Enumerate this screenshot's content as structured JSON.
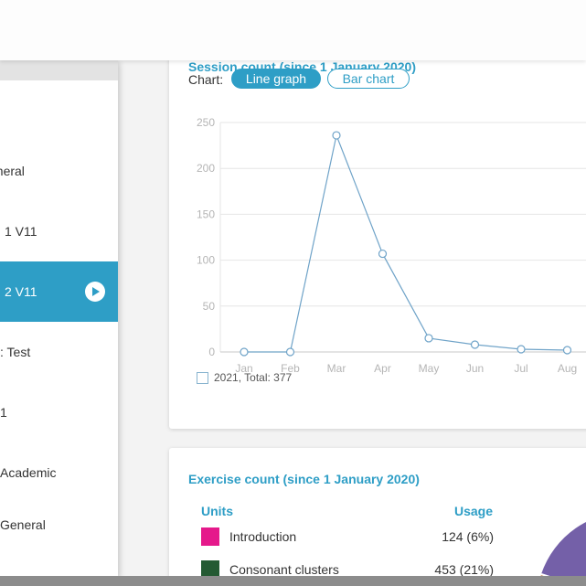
{
  "sidebar": {
    "items": [
      {
        "label": "eneral",
        "active": false
      },
      {
        "label": "1 V11",
        "active": false
      },
      {
        "label": "2 V11",
        "active": true
      },
      {
        "label": ": Test",
        "active": false
      },
      {
        "label": "1",
        "active": false
      },
      {
        "label": "Academic",
        "active": false
      },
      {
        "label": "General",
        "active": false
      }
    ]
  },
  "session_card": {
    "title": "Session count (since 1 January 2020)",
    "chart_label": "Chart:",
    "buttons": {
      "line": "Line graph",
      "bar": "Bar chart"
    },
    "legend": "2021, Total: 377"
  },
  "exercise_card": {
    "title": "Exercise count (since 1 January 2020)",
    "headers": {
      "units": "Units",
      "usage": "Usage"
    },
    "rows": [
      {
        "name": "Introduction",
        "usage": "124 (6%)",
        "color": "#e5198b"
      },
      {
        "name": "Consonant clusters",
        "usage": "453 (21%)",
        "color": "#245a33"
      }
    ],
    "pie_colors": [
      "#7460a8",
      "#c4865a"
    ]
  },
  "chart_data": {
    "type": "line",
    "categories": [
      "Jan",
      "Feb",
      "Mar",
      "Apr",
      "May",
      "Jun",
      "Jul",
      "Aug"
    ],
    "series": [
      {
        "name": "2021, Total: 377",
        "values": [
          0,
          0,
          236,
          107,
          15,
          8,
          3,
          2
        ]
      }
    ],
    "ylim": [
      0,
      250
    ],
    "yticks": [
      0,
      50,
      100,
      150,
      200,
      250
    ],
    "grid": true,
    "legend_position": "bottom-left",
    "color": "#6fa3c8"
  }
}
